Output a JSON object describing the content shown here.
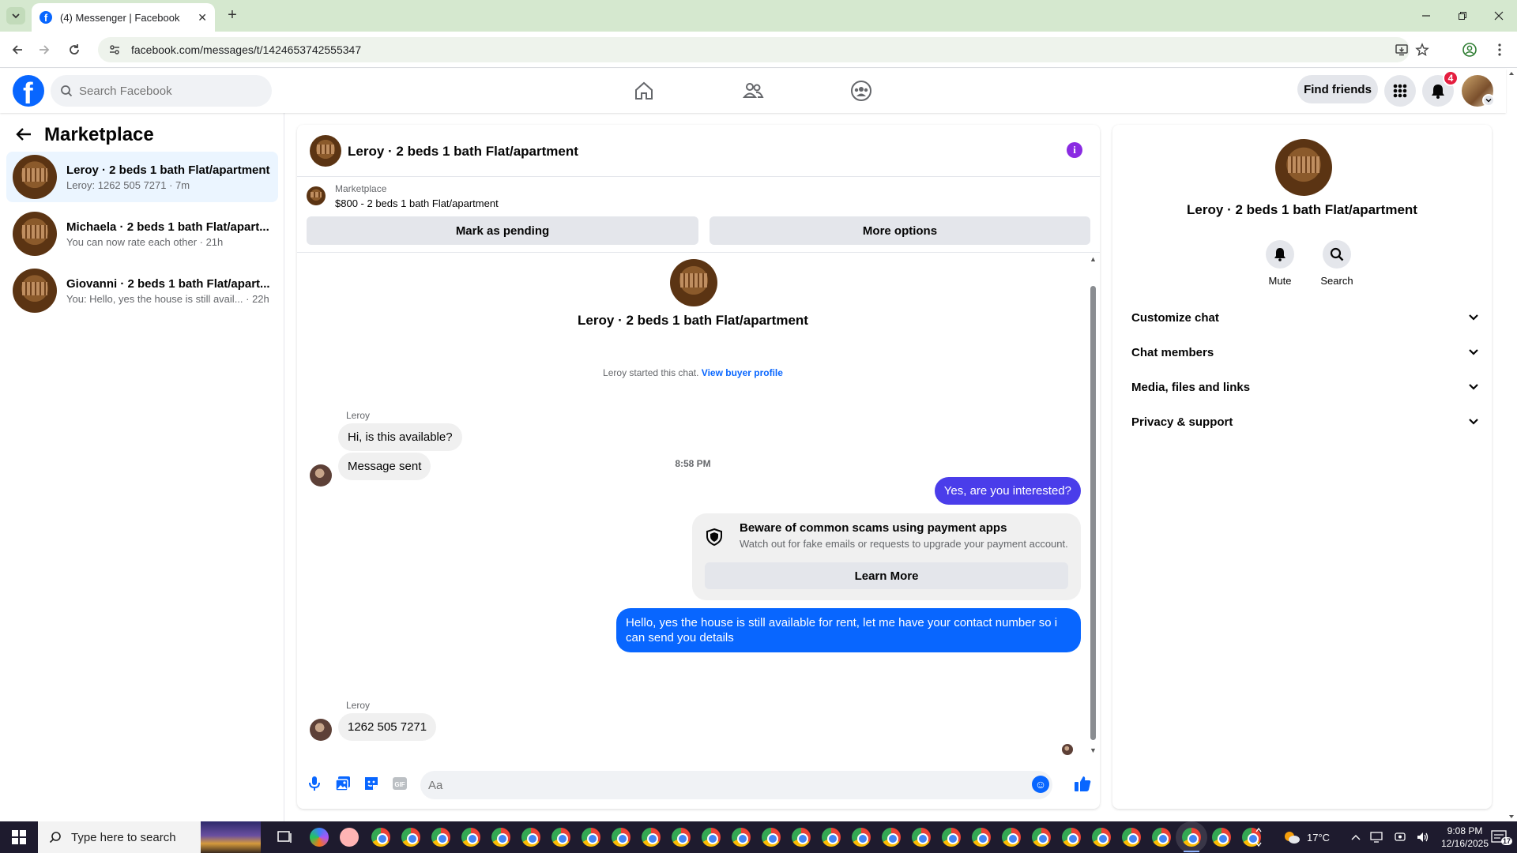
{
  "browser": {
    "tab_title": "(4) Messenger | Facebook",
    "url": "facebook.com/messages/t/1424653742555347"
  },
  "fb_header": {
    "search_placeholder": "Search Facebook",
    "find_friends_label": "Find friends",
    "notification_count": "4"
  },
  "left": {
    "title": "Marketplace",
    "conversations": [
      {
        "name": "Leroy · 2 beds 1 bath Flat/apartment",
        "preview": "Leroy: 1262 505 7271 · 7m"
      },
      {
        "name": "Michaela · 2 beds 1 bath Flat/apart...",
        "preview": "You can now rate each other · 21h"
      },
      {
        "name": "Giovanni · 2 beds 1 bath Flat/apart...",
        "preview": "You: Hello, yes the house is still avail... · 22h"
      }
    ]
  },
  "chat": {
    "header_title": "Leroy · 2 beds 1 bath Flat/apartment",
    "listing_category": "Marketplace",
    "listing_price_title": "$800 - 2 beds 1 bath Flat/apartment",
    "mark_pending_label": "Mark as pending",
    "more_options_label": "More options",
    "conversation_title": "Leroy · 2 beds 1 bath Flat/apartment",
    "started_text": "Leroy started this chat.",
    "view_buyer_profile": "View buyer profile",
    "sender_name": "Leroy",
    "msg_in_1": "Hi, is this available?",
    "msg_in_2": "Message sent",
    "time_separator": "8:58 PM",
    "msg_out_1": "Yes, are you interested?",
    "scam_title": "Beware of common scams using payment apps",
    "scam_body": "Watch out for fake emails or requests to upgrade your payment account.",
    "learn_more": "Learn More",
    "msg_out_2": "Hello, yes the house is still available for rent, let me have your contact number so i can send you details",
    "msg_in_3": "1262 505 7271",
    "composer_placeholder": "Aa"
  },
  "right": {
    "title": "Leroy · 2 beds 1 bath Flat/apartment",
    "mute_label": "Mute",
    "search_label": "Search",
    "sections": [
      "Customize chat",
      "Chat members",
      "Media, files and links",
      "Privacy & support"
    ]
  },
  "taskbar": {
    "search_placeholder": "Type here to search",
    "temperature": "17°C",
    "time": "9:08 PM",
    "date": "12/16/2025",
    "notif_count": "17"
  },
  "colors": {
    "fb_blue": "#0866ff",
    "outgoing_bubble": "#4a3dea",
    "active_conversation": "#ebf5ff",
    "notification_red": "#e41e3f"
  }
}
